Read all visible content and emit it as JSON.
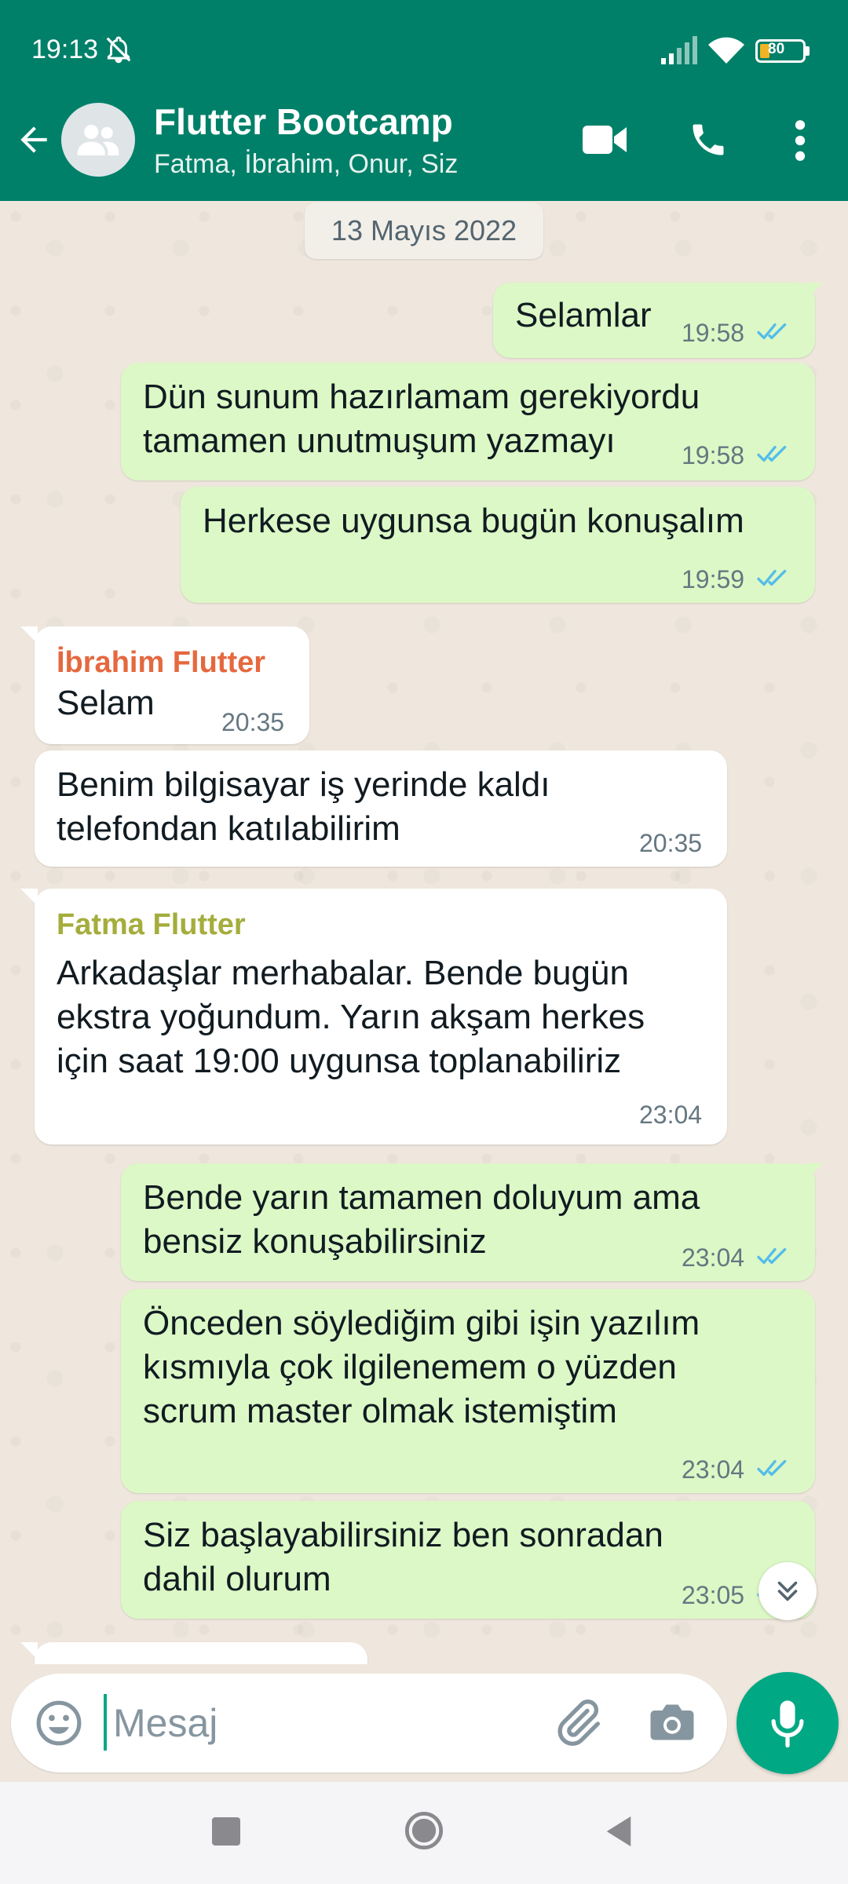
{
  "status_bar": {
    "time": "19:13",
    "battery": "80"
  },
  "header": {
    "title": "Flutter Bootcamp",
    "participants": "Fatma, İbrahim, Onur, Siz"
  },
  "chat": {
    "date": "13 Mayıs 2022",
    "messages": [
      {
        "direction": "outgoing",
        "lines": [
          "Selamlar"
        ],
        "time": "19:58",
        "status": "read"
      },
      {
        "direction": "outgoing",
        "lines": [
          "Dün sunum hazırlamam gerekiyordu",
          "tamamen unutmuşum yazmayı"
        ],
        "time": "19:58",
        "status": "read"
      },
      {
        "direction": "outgoing",
        "lines": [
          "Herkese uygunsa bugün konuşalım"
        ],
        "time": "19:59",
        "status": "read"
      },
      {
        "direction": "incoming",
        "sender": "İbrahim Flutter",
        "sender_color": "#e5683f",
        "lines": [
          "Selam"
        ],
        "time": "20:35"
      },
      {
        "direction": "incoming",
        "lines": [
          "Benim bilgisayar iş yerinde kaldı",
          "telefondan katılabilirim"
        ],
        "time": "20:35"
      },
      {
        "direction": "incoming",
        "sender": "Fatma Flutter",
        "sender_color": "#a5ad3c",
        "lines": [
          "Arkadaşlar merhabalar. Bende bugün",
          "ekstra yoğundum. Yarın akşam herkes",
          "için saat 19:00 uygunsa toplanabiliriz"
        ],
        "time": "23:04"
      },
      {
        "direction": "outgoing",
        "lines": [
          "Bende yarın tamamen doluyum ama",
          "bensiz konuşabilirsiniz"
        ],
        "time": "23:04",
        "status": "read"
      },
      {
        "direction": "outgoing",
        "lines": [
          "Önceden söylediğim gibi işin yazılım",
          "kısmıyla çok ilgilenemem o yüzden",
          "scrum master olmak istemiştim"
        ],
        "time": "23:04",
        "status": "read"
      },
      {
        "direction": "outgoing",
        "lines": [
          "Siz başlayabilirsiniz ben sonradan",
          "dahil olurum"
        ],
        "time": "23:05",
        "status": "read"
      }
    ]
  },
  "input": {
    "placeholder": "Mesaj"
  },
  "colors": {
    "header": "#008069",
    "outgoing_bubble": "#dcf8c6",
    "incoming_bubble": "#ffffff",
    "accent": "#00a884",
    "read_ticks": "#53bdeb"
  },
  "icons": [
    "bell-off-icon",
    "signal-icon",
    "wifi-icon",
    "battery-icon",
    "back-arrow-icon",
    "group-avatar-icon",
    "video-call-icon",
    "voice-call-icon",
    "more-options-icon",
    "double-check-icon",
    "chevron-double-down-icon",
    "emoji-icon",
    "attach-icon",
    "camera-icon",
    "mic-icon"
  ]
}
